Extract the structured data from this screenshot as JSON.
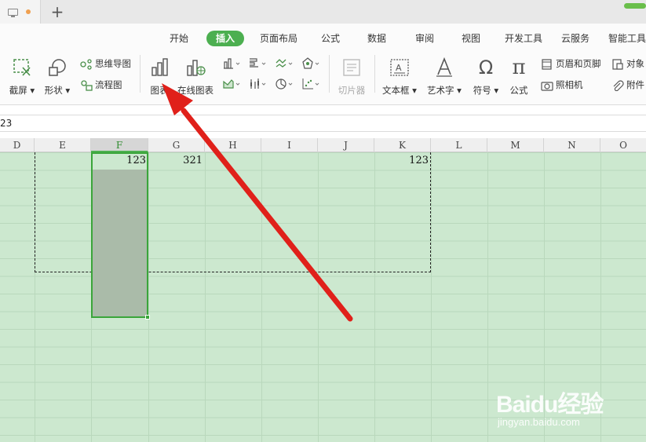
{
  "titlebar": {
    "new_tab_symbol": "+"
  },
  "menu": [
    "开始",
    "插入",
    "页面布局",
    "公式",
    "数据",
    "审阅",
    "视图",
    "开发工具",
    "云服务",
    "智能工具"
  ],
  "active_menu": "插入",
  "toolbar": {
    "screenshot": "截屏",
    "shape": "形状",
    "mindmap": "思维导图",
    "flowchart": "流程图",
    "chart": "图表",
    "online_chart": "在线图表",
    "slicer": "切片器",
    "textbox": "文本框",
    "wordart": "艺术字",
    "symbol": "符号",
    "formula": "公式",
    "header_footer": "页眉和页脚",
    "object": "对象",
    "camera": "照相机",
    "attachment": "附件",
    "symbol_glyph": "Ω",
    "formula_glyph": "π"
  },
  "formula_bar": {
    "value": "23"
  },
  "columns": [
    "D",
    "E",
    "F",
    "G",
    "H",
    "I",
    "J",
    "K",
    "L",
    "M",
    "N",
    "O"
  ],
  "selected_column": "F",
  "cells": {
    "F1": "123",
    "G1": "321",
    "K1": "123"
  },
  "watermark": {
    "brand": "Baidu经验",
    "site": "jingyan.baidu.com"
  },
  "colors": {
    "accent": "#4caf50",
    "sheet_bg": "#cce8cf",
    "arrow": "#e0201a"
  }
}
